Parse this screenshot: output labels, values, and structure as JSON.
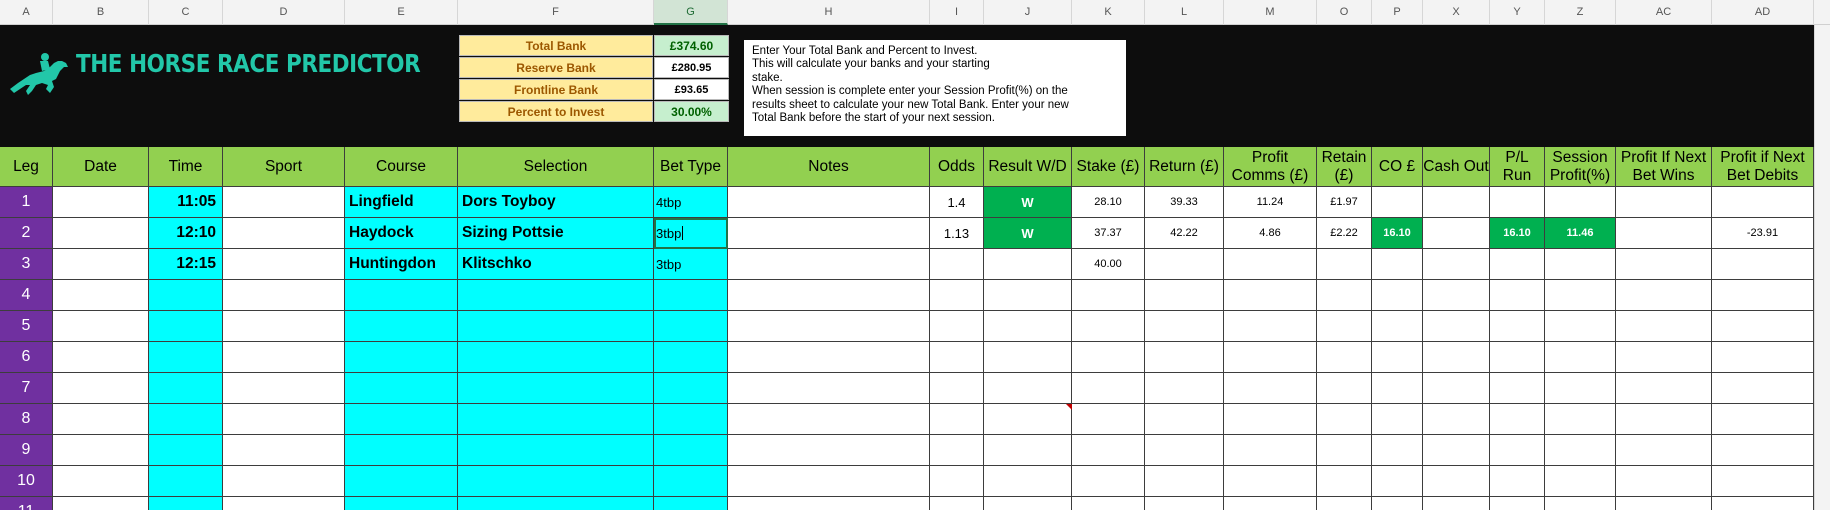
{
  "columns": [
    "A",
    "B",
    "C",
    "D",
    "E",
    "F",
    "G",
    "H",
    "I",
    "J",
    "K",
    "L",
    "M",
    "O",
    "P",
    "X",
    "Y",
    "Z",
    "AC",
    "AD"
  ],
  "selected_column": "G",
  "app": {
    "logo_text": "THE HORSE RACE PREDICTOR"
  },
  "bank": [
    {
      "label": "Total Bank",
      "value": "£374.60",
      "style": "green"
    },
    {
      "label": "Reserve Bank",
      "value": "£280.95",
      "style": "plain"
    },
    {
      "label": "Frontline Bank",
      "value": "£93.65",
      "style": "plain"
    },
    {
      "label": "Percent to Invest",
      "value": "30.00%",
      "style": "green"
    }
  ],
  "instructions": [
    "Enter Your Total Bank and Percent to Invest.",
    "This will calculate your banks and your starting",
    "stake.",
    "When session is complete enter your Session Profit(%) on the",
    "results sheet to calculate your new Total Bank. Enter your new",
    "Total Bank before the start of your next session."
  ],
  "headers": [
    "Leg",
    "Date",
    "Time",
    "Sport",
    "Course",
    "Selection",
    "Bet Type",
    "Notes",
    "Odds",
    "Result W/D",
    "Stake (£)",
    "Return (£)",
    "Profit Comms (£)",
    "Retain (£)",
    "CO £",
    "Cash Out",
    "P/L Run",
    "Session Profit(%)",
    "Profit If Next Bet Wins",
    "Profit if Next Bet Debits"
  ],
  "rows": [
    {
      "leg": "1",
      "time": "11:05",
      "course": "Lingfield",
      "selection": "Dors Toyboy",
      "bet_type": "4tbp",
      "odds": "1.4",
      "result": "W",
      "stake": "28.10",
      "return": "39.33",
      "profit": "11.24",
      "retain": "£1.97",
      "co": "",
      "pl_run": "",
      "session_profit": "",
      "next_debits": ""
    },
    {
      "leg": "2",
      "time": "12:10",
      "course": "Haydock",
      "selection": "Sizing Pottsie",
      "bet_type": "3tbp",
      "odds": "1.13",
      "result": "W",
      "stake": "37.37",
      "return": "42.22",
      "profit": "4.86",
      "retain": "£2.22",
      "co": "16.10",
      "pl_run": "16.10",
      "session_profit": "11.46",
      "next_debits": "-23.91"
    },
    {
      "leg": "3",
      "time": "12:15",
      "course": "Huntingdon",
      "selection": "Klitschko",
      "bet_type": "3tbp",
      "odds": "",
      "result": "",
      "stake": "40.00",
      "return": "",
      "profit": "",
      "retain": "",
      "co": "",
      "pl_run": "",
      "session_profit": "",
      "next_debits": ""
    },
    {
      "leg": "4"
    },
    {
      "leg": "5"
    },
    {
      "leg": "6"
    },
    {
      "leg": "7"
    },
    {
      "leg": "8"
    },
    {
      "leg": "9"
    },
    {
      "leg": "10"
    },
    {
      "leg": "11"
    }
  ],
  "colors": {
    "header_green": "#92d050",
    "leg_purple": "#7030a0",
    "input_cyan": "#00ffff",
    "win_green": "#00b050",
    "logo_teal": "#22c7a9"
  }
}
